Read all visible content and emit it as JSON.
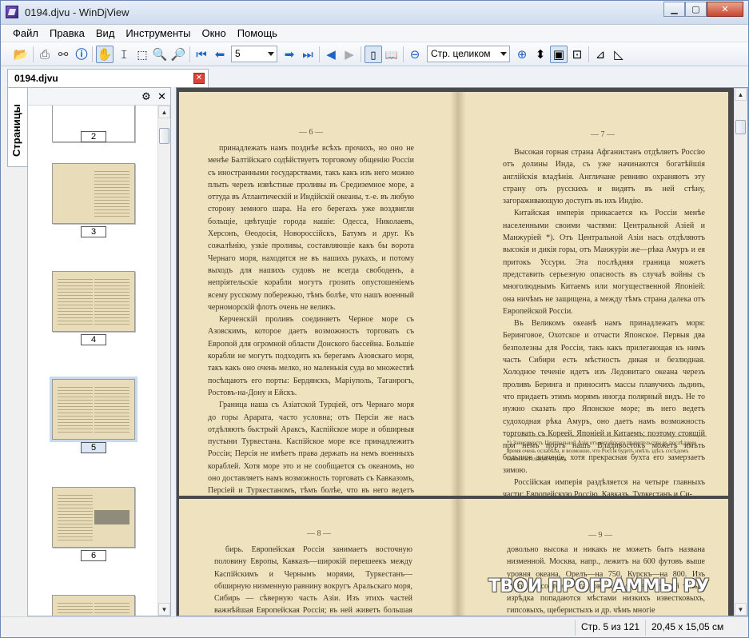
{
  "window": {
    "title": "0194.djvu - WinDjView",
    "minimize": "▁",
    "maximize": "▢",
    "close": "✕"
  },
  "menu": [
    "Файл",
    "Правка",
    "Вид",
    "Инструменты",
    "Окно",
    "Помощь"
  ],
  "toolbar": {
    "page_value": "5",
    "zoom_value": "Стр. целиком"
  },
  "tab": {
    "label": "0194.djvu",
    "close": "✕"
  },
  "sidebar": {
    "tab_label": "Страницы",
    "settings_icon": "⚙",
    "close_icon": "✕",
    "thumbnails": [
      {
        "label": "2"
      },
      {
        "label": "3"
      },
      {
        "label": "4"
      },
      {
        "label": "5",
        "selected": true
      },
      {
        "label": "6"
      }
    ]
  },
  "pages": [
    {
      "left_num": "— 6 —",
      "right_num": "— 7 —",
      "left_text": [
        "принадлежать намъ позднѣе всѣхъ прочихъ, но оно не менѣе Балтійскаго содѣйствуетъ торговому общенію Россіи съ иностранными государствами, такъ какъ изъ него можно плыть черезъ извѣстные проливы въ Средиземное море, а оттуда въ Атлантическій и Индійскій океаны, т.-е. въ любую сторону земного шара. На его берегахъ уже воздвигли больщіе, цвѣтущіе города нашіе: Одесса, Николаевъ, Херсонъ, Өеодосія, Новороссійскъ, Батумъ и друг. Къ сожалѣнію, узкіе проливы, составляющіе какъ бы ворота Чернаго моря, находятся не въ нашихъ рукахъ, и потому выходъ для нашихъ судовъ не всегда свободенъ, а непріятельскіе корабли могутъ грозить опустошеніемъ всему русскому побережью, тѣмъ болѣе, что нашъ военный черноморскій флотъ очень не великъ.",
        "Керченскій проливъ соединяетъ Черное море съ Азовскимъ, которое даетъ возможность торговать съ Европой для огромной области Донского бассейна. Большіе корабли не могутъ подходить къ берегамъ Азовскаго моря, такъ какъ оно очень мелко, но маленькія суда во множествѣ посѣщаютъ его порты: Бердянскъ, Маріуполь, Таганрогъ, Ростовъ-на-Дону и Ейскъ.",
        "Граница наша съ Азіатской Турціей, отъ Чернаго моря до горы Арарата, часто условна; отъ Персіи же насъ отдѣляютъ быстрый Араксъ, Каспійское море и обширныя пустыни Туркестана. Каспійское море все принадлежитъ Россіи; Персія не имѣетъ права держать на немъ военныхъ кораблей. Хотя море это и не сообщается съ океаномъ, но оно доставляетъ намъ возможность торговать съ Кавказомъ, Персіей и Туркестаномъ, тѣмъ болѣе, что въ него ведетъ главный водный путь намъ—Волга. Стоящая при устьѣ Волги Астрахань есть главнѣйшій портъ на Каспійскомъ морѣ."
      ],
      "right_text": [
        "Высокая горная страна Афганистанъ отдѣляетъ Россію отъ долины Инда, съ уже начинаются богатѣйшія англійскія владѣнія. Англичане ревниво охраняютъ эту страну отъ русскихъ и видятъ въ ней стѣну, загораживающую доступъ въ ихъ Индію.",
        "Китайская имперія прикасается къ Россіи менѣе населенными своими частями: Центральной Азіей и Манжуріей *). Отъ Центральной Азіи насъ отдѣляютъ высокія и дикія горы, отъ Манжуріи же—рѣка Амуръ и ея притокъ Уссури. Эта послѣдняя граница можетъ представить серьезную опасность въ случаѣ войны съ многолюднымъ Китаемъ или могущественной Японіей: она ничѣмъ не защищена, а между тѣмъ страна далека отъ Европейской Россіи.",
        "Въ Великомъ океанѣ намъ принадлежатъ моря: Беринговое, Охотское и отчасти Японское. Первыя два безполезны для Россіи, такъ какъ прилегающая къ нимъ часть Сибири есть мѣстность дикая и безлюдная. Холодное теченіе идетъ изъ Ледовитаго океана черезъ проливъ Беринга и приноситъ массы плавучихъ льдинъ, что придаетъ этимъ морямъ иногда полярный видъ. Не то нужно сказать про Японское море; въ него ведетъ судоходная рѣка Амуръ, оно даетъ намъ возможность торговать съ Кореей, Японіей и Китаемъ; поэтому стоящій при немъ портъ нашъ Владивостокъ можетъ имѣть большое значеніе, хотя прекрасная бухта его замерзаетъ зимою.",
        "Россійская имперія раздѣляется на четыре главныхъ части: Европейскую Россію, Кавказъ, Туркестанъ и Си-"
      ],
      "footnote": "*) Зависимость Центральной Азіи отъ китайскаго правительства въ послѣднее время очень ослабѣла, и возможно, что Россія будетъ имѣть здѣсь сосѣдомъ самостоятельную страну."
    },
    {
      "left_num": "— 8 —",
      "right_num": "— 9 —",
      "left_text": [
        "бирь. Европейская Россія занимаетъ восточную половину Европы, Кавказъ—широкій перешеекъ между Каспійскимъ и Чернымъ морями, Туркестанъ—обширную низменную равнину вокругъ Аральскаго моря, Сибирь — сѣверную часть Азіи. Изъ этихъ частей важнѣйшая Европейская Россія; въ ней живетъ большая часть населенія Имперіи, въ ней главнѣйшіе города россіи, въ ней наибольшее развитіе промышленности, торговли и просвѣщенія."
      ],
      "right_text": [
        "довольно высока и никакъ не можетъ быть названа низменной. Москва, напр., лежитъ на 600 футовъ выше уровня океана, Орелъ—на 750, Курскъ—на 800. Изъ всего же состоитъ эта ровная земля, въ которой только изрѣдка попадаются мѣстами низкихъ известковыхъ, гипсовыхъ, щеберистыхъ и др. чѣмъ многіе"
      ]
    }
  ],
  "watermark": "ТВОИ ПРОГРАММЫ РУ",
  "status": {
    "page": "Стр. 5 из 121",
    "size": "20,45 x 15,05 см"
  }
}
